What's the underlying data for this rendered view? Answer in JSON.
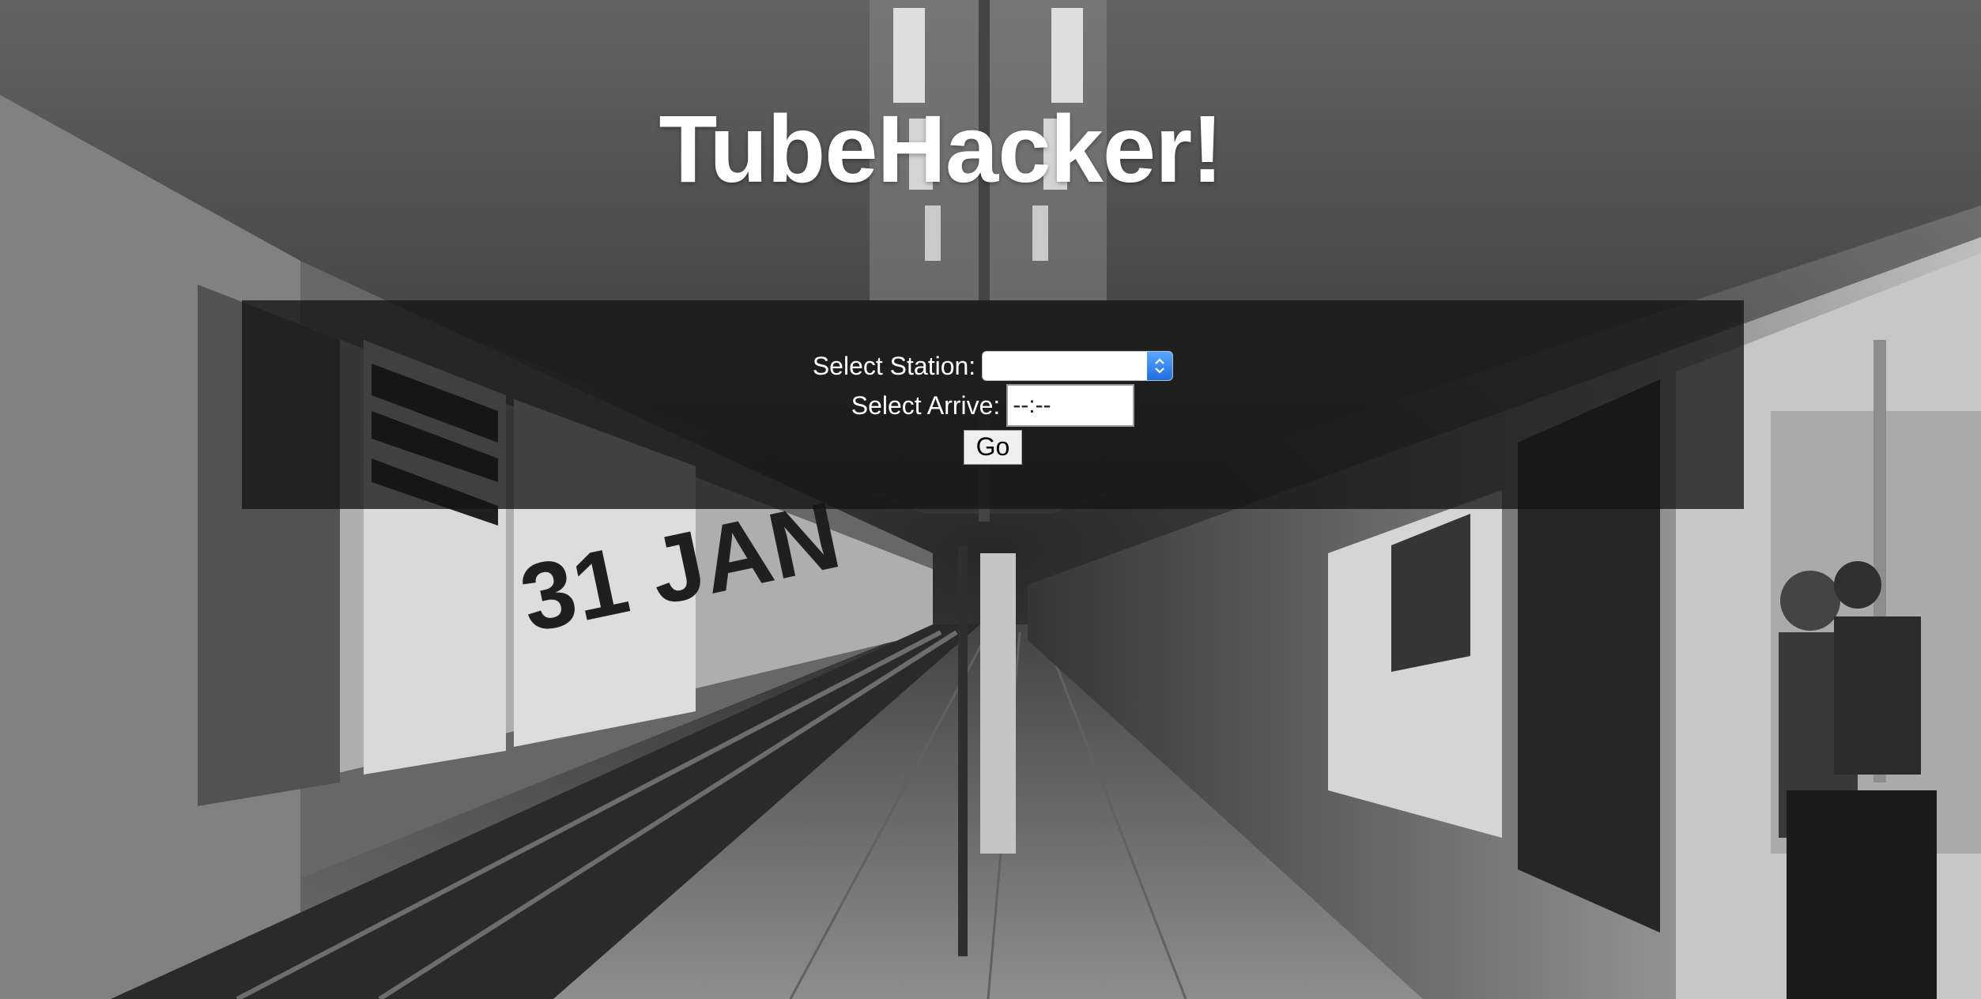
{
  "page": {
    "title": "TubeHacker!"
  },
  "form": {
    "station_label": "Select Station:",
    "station_value": "",
    "arrive_label": "Select Arrive:",
    "arrive_value": "--:--",
    "go_label": "Go"
  },
  "icons": {
    "select_stepper": "chevron-up-down-icon"
  },
  "colors": {
    "panel_overlay": "#141414",
    "title": "#ffffff",
    "stepper_blue": "#2a7cf0"
  }
}
